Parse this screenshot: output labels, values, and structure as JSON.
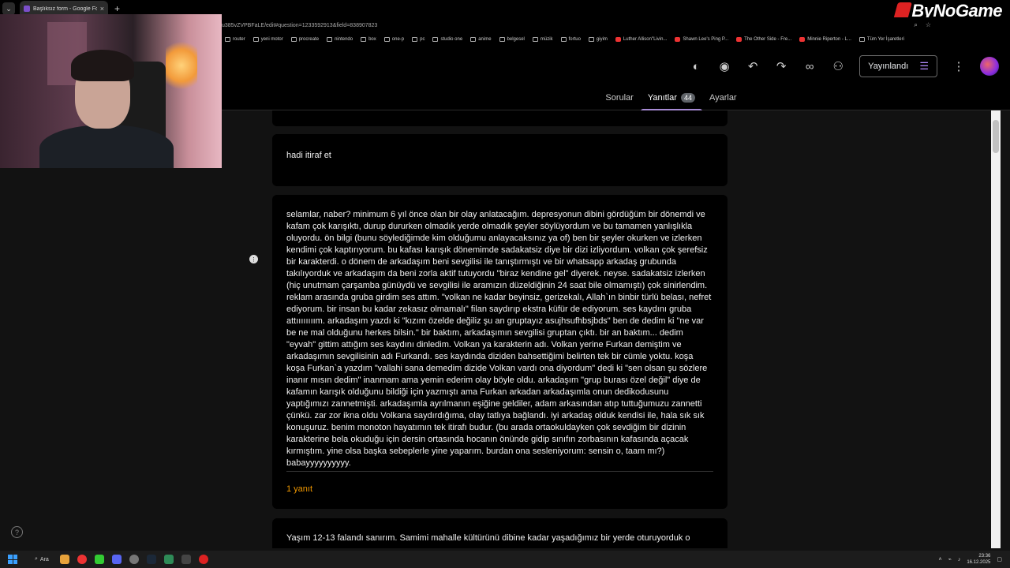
{
  "browser": {
    "tab_title": "Başlıksız form - Google Formlar",
    "tab_close": "×",
    "new_tab": "+",
    "url": "u385vZVPBFaLE/edit#question=1233592913&field=838907823",
    "brand": "ByNoGame",
    "bookmarks": [
      "router",
      "yeni motor",
      "procreate",
      "nintendo",
      "box",
      "one-p",
      "pc",
      "studio one",
      "anime",
      "belgesel",
      "müzik",
      "fortuo",
      "giyim",
      "Luther Allison\"Livin...",
      "Shawn Lee's Ping P...",
      "The Other Side - Fre...",
      "Minnie Riperton - L...",
      "Tüm Yer İşaretleri"
    ]
  },
  "forms": {
    "publish_label": "Yayınlandı",
    "tabs": {
      "questions": "Sorular",
      "responses": "Yanıtlar",
      "responses_count": "44",
      "settings": "Ayarlar"
    },
    "question_text": "hadi itiraf et",
    "response_text": "selamlar, naber? minimum 6 yıl önce olan bir olay anlatacağım. depresyonun dibini gördüğüm bir dönemdi ve kafam çok karışıktı, durup dururken olmadık yerde olmadık şeyler söylüyordum ve bu tamamen yanlışlıkla oluyordu. ön bilgi (bunu söylediğimde kim olduğumu anlayacaksınız ya of) ben bir şeyler okurken ve izlerken kendimi çok kaptırıyorum. bu kafası karışık dönemimde sadakatsiz diye bir dizi izliyordum. volkan çok şerefsiz bir karakterdi. o dönem de arkadaşım beni sevgilisi ile tanıştırmıştı ve bir whatsapp arkadaş grubunda takılıyorduk ve arkadaşım da beni zorla aktif tutuyordu \"biraz kendine gel\" diyerek. neyse. sadakatsiz izlerken (hiç unutmam çarşamba günüydü ve sevgilisi ile aramızın düzeldiğinin 24 saat bile olmamıştı) çok sinirlendim. reklam arasında gruba girdim ses attım. \"volkan ne kadar beyinsiz, gerizekalı, Allah`ın binbir türlü belası, nefret ediyorum. bir insan bu kadar zekasız olmamalı\" filan saydırıp ekstra küfür de ediyorum. ses kaydını gruba attıııııııım. arkadaşım yazdı ki \"kızım özelde değiliz şu an gruptayız asujhsufhbsjbds\" ben de dedim ki \"ne var be ne mal olduğunu herkes bilsin.\" bir baktım, arkadaşımın sevgilisi gruptan çıktı. bir an baktım... dedim \"eyvah\" gittim attığım ses kaydını dinledim. Volkan ya karakterin adı. Volkan yerine Furkan demiştim ve arkadaşımın sevgilisinin adı Furkandı. ses kaydında diziden bahsettiğimi belirten tek bir cümle yoktu. koşa koşa Furkan`a yazdım \"vallahi sana demedim dizide Volkan vardı ona diyordum\" dedi ki \"sen olsan şu sözlere inanır mısın dedim\" inanmam ama yemin ederim olay böyle oldu. arkadaşım \"grup burası özel değil\" diye de kafamın karışık olduğunu bildiği için yazmıştı ama Furkan arkadan arkadaşımla onun dedikodusunu yaptığımızı zannetmişti. arkadaşımla ayrılmanın eşiğine geldiler, adam arkasından atıp tuttuğumuzu zannetti çünkü. zar zor ikna oldu Volkana saydırdığıma, olay tatlıya bağlandı. iyi arkadaş olduk kendisi ile, hala sık sık konuşuruz. benim monoton hayatımın tek itirafı budur. (bu arada ortaokuldayken çok sevdiğim bir dizinin karakterine bela okuduğu için dersin ortasında hocanın önünde gidip sınıfın zorbasının kafasında açacak kırmıştım. yine olsa başka sebeplerle yine yaparım. burdan ona sesleniyorum: sensin o, taam mı?) babayyyyyyyyyy.",
    "reply_count": "1 yanıt",
    "next_response_text": "Yaşım 12-13 falandı sanırım. Samimi mahalle kültürünü dibine kadar yaşadığımız bir yerde oturuyorduk o"
  },
  "taskbar": {
    "search_label": "Ara",
    "time": "23:36",
    "date": "16.12.2025"
  },
  "colors": {
    "accent": "#a78bd4",
    "reply": "#f29900",
    "card_bg": "#000000",
    "page_bg": "#121212"
  }
}
